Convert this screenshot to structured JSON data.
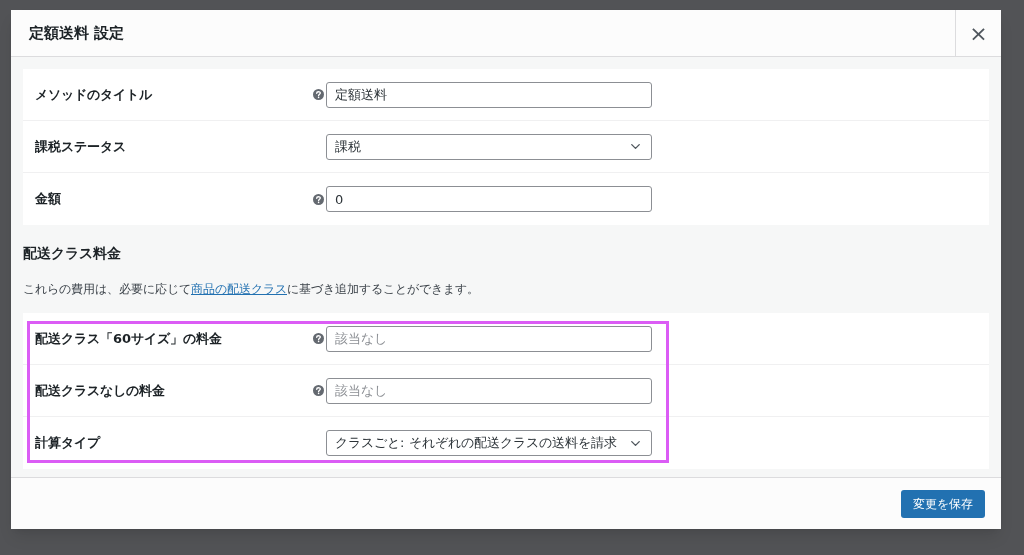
{
  "modal": {
    "title": "定額送料 設定",
    "close": "×"
  },
  "method_fields": [
    {
      "kind": "text",
      "label": "メソッドのタイトル",
      "help": true,
      "value": "定額送料"
    },
    {
      "kind": "select",
      "label": "課税ステータス",
      "help": false,
      "value": "課税"
    },
    {
      "kind": "text",
      "label": "金額",
      "help": true,
      "value": "0"
    }
  ],
  "class_costs": {
    "heading": "配送クラス料金",
    "description_before": "これらの費用は、必要に応じて",
    "link": "商品の配送クラス",
    "description_after": "に基づき追加することができます。",
    "highlighted": true,
    "fields": [
      {
        "kind": "text",
        "label": "配送クラス「60サイズ」の料金",
        "help": true,
        "placeholder": "該当なし"
      },
      {
        "kind": "text",
        "label": "配送クラスなしの料金",
        "help": true,
        "placeholder": "該当なし"
      },
      {
        "kind": "select",
        "label": "計算タイプ",
        "help": false,
        "value": "クラスごと: それぞれの配送クラスの送料を請求"
      }
    ]
  },
  "footer": {
    "save_button": "変更を保存"
  }
}
